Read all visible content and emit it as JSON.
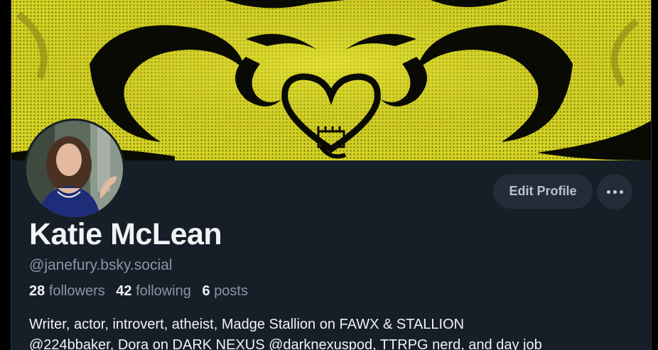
{
  "profile": {
    "display_name": "Katie McLean",
    "handle": "@janefury.bsky.social",
    "stats": {
      "followers_count": "28",
      "followers_label": "followers",
      "following_count": "42",
      "following_label": "following",
      "posts_count": "6",
      "posts_label": "posts"
    },
    "bio_lines": [
      "Writer, actor, introvert, atheist, Madge Stallion on FAWX & STALLION",
      "@224bbaker, Dora on DARK NEXUS @darknexuspod, TTRPG nerd, and day job"
    ]
  },
  "actions": {
    "edit_profile_label": "Edit Profile",
    "more_icon": "ellipsis-icon"
  },
  "colors": {
    "background": "#161e27",
    "button_bg": "#232c38",
    "banner_yellow": "#c9c51f",
    "text_primary": "#f1f3f5",
    "text_secondary": "#8a96a6"
  }
}
